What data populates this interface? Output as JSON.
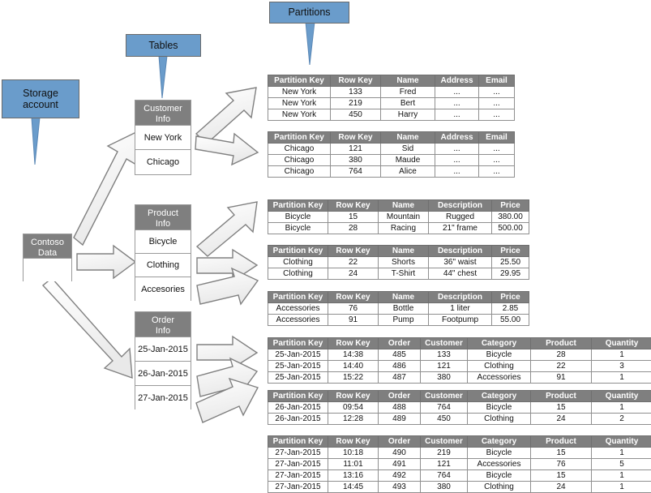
{
  "diagram": {
    "title": "Azure Storage Table Partitioning",
    "colors": {
      "callout_blue": "#6A9CCB",
      "header_gray": "#7F7F7F",
      "border_gray": "#9A9A9A",
      "arrow_fill": "#F2F2F2"
    }
  },
  "callouts": [
    {
      "id": "storage-account",
      "label": "Storage\naccount",
      "line1": "Storage",
      "line2": "account"
    },
    {
      "id": "tables",
      "label": "Tables",
      "line1": "Tables",
      "line2": ""
    },
    {
      "id": "partitions",
      "label": "Partitions",
      "line1": "Partitions",
      "line2": ""
    }
  ],
  "entities": {
    "storage": {
      "head1": "Contoso",
      "head2": "Data",
      "rows": [
        ""
      ]
    },
    "customer_info": {
      "head1": "Customer",
      "head2": "Info",
      "rows": [
        "New York",
        "Chicago"
      ]
    },
    "product_info": {
      "head1": "Product",
      "head2": "Info",
      "rows": [
        "Bicycle",
        "Clothing",
        "Accesories"
      ]
    },
    "order_info": {
      "head1": "Order",
      "head2": "Info",
      "rows": [
        "25-Jan-2015",
        "26-Jan-2015",
        "27-Jan-2015"
      ]
    }
  },
  "tables": [
    {
      "id": "partition-newyork",
      "columns": [
        "Partition Key",
        "Row Key",
        "Name",
        "Address",
        "Email"
      ],
      "rows": [
        [
          "New York",
          "133",
          "Fred",
          "...",
          "..."
        ],
        [
          "New York",
          "219",
          "Bert",
          "...",
          "..."
        ],
        [
          "New York",
          "450",
          "Harry",
          "...",
          "..."
        ]
      ]
    },
    {
      "id": "partition-chicago",
      "columns": [
        "Partition Key",
        "Row Key",
        "Name",
        "Address",
        "Email"
      ],
      "rows": [
        [
          "Chicago",
          "121",
          "Sid",
          "...",
          "..."
        ],
        [
          "Chicago",
          "380",
          "Maude",
          "...",
          "..."
        ],
        [
          "Chicago",
          "764",
          "Alice",
          "...",
          "..."
        ]
      ]
    },
    {
      "id": "partition-bicycle",
      "columns": [
        "Partition Key",
        "Row Key",
        "Name",
        "Description",
        "Price"
      ],
      "rows": [
        [
          "Bicycle",
          "15",
          "Mountain",
          "Rugged",
          "380.00"
        ],
        [
          "Bicycle",
          "28",
          "Racing",
          "21\" frame",
          "500.00"
        ]
      ]
    },
    {
      "id": "partition-clothing",
      "columns": [
        "Partition Key",
        "Row Key",
        "Name",
        "Description",
        "Price"
      ],
      "rows": [
        [
          "Clothing",
          "22",
          "Shorts",
          "36\" waist",
          "25.50"
        ],
        [
          "Clothing",
          "24",
          "T-Shirt",
          "44\" chest",
          "29.95"
        ]
      ]
    },
    {
      "id": "partition-accessories",
      "columns": [
        "Partition Key",
        "Row Key",
        "Name",
        "Description",
        "Price"
      ],
      "rows": [
        [
          "Accessories",
          "76",
          "Bottle",
          "1 liter",
          "2.85"
        ],
        [
          "Accessories",
          "91",
          "Pump",
          "Footpump",
          "55.00"
        ]
      ]
    },
    {
      "id": "partition-25-jan-2015",
      "columns": [
        "Partition Key",
        "Row Key",
        "Order",
        "Customer",
        "Category",
        "Product",
        "Quantity"
      ],
      "rows": [
        [
          "25-Jan-2015",
          "14:38",
          "485",
          "133",
          "Bicycle",
          "28",
          "1"
        ],
        [
          "25-Jan-2015",
          "14:40",
          "486",
          "121",
          "Clothing",
          "22",
          "3"
        ],
        [
          "25-Jan-2015",
          "15:22",
          "487",
          "380",
          "Accessories",
          "91",
          "1"
        ]
      ]
    },
    {
      "id": "partition-26-jan-2015",
      "columns": [
        "Partition Key",
        "Row Key",
        "Order",
        "Customer",
        "Category",
        "Product",
        "Quantity"
      ],
      "rows": [
        [
          "26-Jan-2015",
          "09:54",
          "488",
          "764",
          "Bicycle",
          "15",
          "1"
        ],
        [
          "26-Jan-2015",
          "12:28",
          "489",
          "450",
          "Clothing",
          "24",
          "2"
        ]
      ]
    },
    {
      "id": "partition-27-jan-2015",
      "columns": [
        "Partition Key",
        "Row Key",
        "Order",
        "Customer",
        "Category",
        "Product",
        "Quantity"
      ],
      "rows": [
        [
          "27-Jan-2015",
          "10:18",
          "490",
          "219",
          "Bicycle",
          "15",
          "1"
        ],
        [
          "27-Jan-2015",
          "11:01",
          "491",
          "121",
          "Accessories",
          "76",
          "5"
        ],
        [
          "27-Jan-2015",
          "13:16",
          "492",
          "764",
          "Bicycle",
          "15",
          "1"
        ],
        [
          "27-Jan-2015",
          "14:45",
          "493",
          "380",
          "Clothing",
          "24",
          "1"
        ]
      ]
    }
  ]
}
